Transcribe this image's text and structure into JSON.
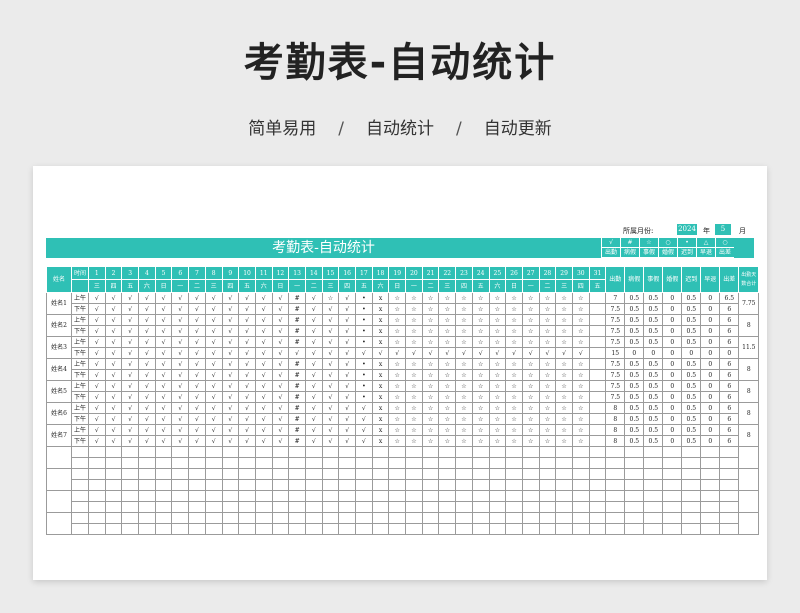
{
  "hero": {
    "title": "考勤表-自动统计"
  },
  "subtitle": {
    "items": [
      "简单易用",
      "自动统计",
      "自动更新"
    ],
    "sep": "/"
  },
  "month_row": {
    "label": "所属月份:",
    "year": "2024",
    "year_unit": "年",
    "month": "5",
    "month_unit": "月"
  },
  "sheet_title": "考勤表-自动统计",
  "legend": {
    "symbols": [
      "√",
      "#",
      "☆",
      "○",
      "•",
      "△",
      "○"
    ],
    "labels": [
      "出勤",
      "病假",
      "事假",
      "婚假",
      "迟到",
      "早退",
      "出差"
    ]
  },
  "header": {
    "name": "姓名",
    "time": "时间",
    "days": [
      "1",
      "2",
      "3",
      "4",
      "5",
      "6",
      "7",
      "8",
      "9",
      "10",
      "11",
      "12",
      "13",
      "14",
      "15",
      "16",
      "17",
      "18",
      "19",
      "20",
      "21",
      "22",
      "23",
      "24",
      "25",
      "26",
      "27",
      "28",
      "29",
      "30",
      "31"
    ],
    "weekdays": [
      "三",
      "四",
      "五",
      "六",
      "日",
      "一",
      "二",
      "三",
      "四",
      "五",
      "六",
      "日",
      "一",
      "二",
      "三",
      "四",
      "五",
      "六",
      "日",
      "一",
      "二",
      "三",
      "四",
      "五",
      "六",
      "日",
      "一",
      "二",
      "三",
      "四",
      "五"
    ],
    "stats": [
      "出勤",
      "病假",
      "事假",
      "婚假",
      "迟到",
      "早退",
      "出差"
    ],
    "total": "出勤天数合计"
  },
  "employees": [
    {
      "name": "姓名1",
      "total": "7.75",
      "rows": [
        {
          "time": "上午",
          "marks": [
            "√",
            "√",
            "√",
            "√",
            "√",
            "√",
            "√",
            "√",
            "√",
            "√",
            "√",
            "√",
            "#",
            "√",
            "☆",
            "√",
            "•",
            "x",
            "☆",
            "☆",
            "☆",
            "☆",
            "☆",
            "☆",
            "☆",
            "☆",
            "☆",
            "☆",
            "☆",
            "☆",
            ""
          ],
          "stats": [
            "7",
            "0.5",
            "0.5",
            "0",
            "0.5",
            "0",
            "6.5"
          ]
        },
        {
          "time": "下午",
          "marks": [
            "√",
            "√",
            "√",
            "√",
            "√",
            "√",
            "√",
            "√",
            "√",
            "√",
            "√",
            "√",
            "#",
            "√",
            "√",
            "√",
            "•",
            "x",
            "☆",
            "☆",
            "☆",
            "☆",
            "☆",
            "☆",
            "☆",
            "☆",
            "☆",
            "☆",
            "☆",
            "☆",
            ""
          ],
          "stats": [
            "7.5",
            "0.5",
            "0.5",
            "0",
            "0.5",
            "0",
            "6"
          ]
        }
      ]
    },
    {
      "name": "姓名2",
      "total": "8",
      "rows": [
        {
          "time": "上午",
          "marks": [
            "√",
            "√",
            "√",
            "√",
            "√",
            "√",
            "√",
            "√",
            "√",
            "√",
            "√",
            "√",
            "#",
            "√",
            "√",
            "√",
            "•",
            "x",
            "☆",
            "☆",
            "☆",
            "☆",
            "☆",
            "☆",
            "☆",
            "☆",
            "☆",
            "☆",
            "☆",
            "☆",
            ""
          ],
          "stats": [
            "7.5",
            "0.5",
            "0.5",
            "0",
            "0.5",
            "0",
            "6"
          ]
        },
        {
          "time": "下午",
          "marks": [
            "√",
            "√",
            "√",
            "√",
            "√",
            "√",
            "√",
            "√",
            "√",
            "√",
            "√",
            "√",
            "#",
            "√",
            "√",
            "√",
            "•",
            "x",
            "☆",
            "☆",
            "☆",
            "☆",
            "☆",
            "☆",
            "☆",
            "☆",
            "☆",
            "☆",
            "☆",
            "☆",
            ""
          ],
          "stats": [
            "7.5",
            "0.5",
            "0.5",
            "0",
            "0.5",
            "0",
            "6"
          ]
        }
      ]
    },
    {
      "name": "姓名3",
      "total": "11.5",
      "rows": [
        {
          "time": "上午",
          "marks": [
            "√",
            "√",
            "√",
            "√",
            "√",
            "√",
            "√",
            "√",
            "√",
            "√",
            "√",
            "√",
            "#",
            "√",
            "√",
            "√",
            "•",
            "x",
            "☆",
            "☆",
            "☆",
            "☆",
            "☆",
            "☆",
            "☆",
            "☆",
            "☆",
            "☆",
            "☆",
            "☆",
            ""
          ],
          "stats": [
            "7.5",
            "0.5",
            "0.5",
            "0",
            "0.5",
            "0",
            "6"
          ]
        },
        {
          "time": "下午",
          "marks": [
            "√",
            "√",
            "√",
            "√",
            "√",
            "√",
            "√",
            "√",
            "√",
            "√",
            "√",
            "√",
            "√",
            "√",
            "√",
            "√",
            "√",
            "√",
            "√",
            "√",
            "√",
            "√",
            "√",
            "√",
            "√",
            "√",
            "√",
            "√",
            "√",
            "√",
            ""
          ],
          "stats": [
            "15",
            "0",
            "0",
            "0",
            "0",
            "0",
            "0"
          ]
        }
      ]
    },
    {
      "name": "姓名4",
      "total": "8",
      "rows": [
        {
          "time": "上午",
          "marks": [
            "√",
            "√",
            "√",
            "√",
            "√",
            "√",
            "√",
            "√",
            "√",
            "√",
            "√",
            "√",
            "#",
            "√",
            "√",
            "√",
            "•",
            "x",
            "☆",
            "☆",
            "☆",
            "☆",
            "☆",
            "☆",
            "☆",
            "☆",
            "☆",
            "☆",
            "☆",
            "☆",
            ""
          ],
          "stats": [
            "7.5",
            "0.5",
            "0.5",
            "0",
            "0.5",
            "0",
            "6"
          ]
        },
        {
          "time": "下午",
          "marks": [
            "√",
            "√",
            "√",
            "√",
            "√",
            "√",
            "√",
            "√",
            "√",
            "√",
            "√",
            "√",
            "#",
            "√",
            "√",
            "√",
            "•",
            "x",
            "☆",
            "☆",
            "☆",
            "☆",
            "☆",
            "☆",
            "☆",
            "☆",
            "☆",
            "☆",
            "☆",
            "☆",
            ""
          ],
          "stats": [
            "7.5",
            "0.5",
            "0.5",
            "0",
            "0.5",
            "0",
            "6"
          ]
        }
      ]
    },
    {
      "name": "姓名5",
      "total": "8",
      "rows": [
        {
          "time": "上午",
          "marks": [
            "√",
            "√",
            "√",
            "√",
            "√",
            "√",
            "√",
            "√",
            "√",
            "√",
            "√",
            "√",
            "#",
            "√",
            "√",
            "√",
            "•",
            "x",
            "☆",
            "☆",
            "☆",
            "☆",
            "☆",
            "☆",
            "☆",
            "☆",
            "☆",
            "☆",
            "☆",
            "☆",
            ""
          ],
          "stats": [
            "7.5",
            "0.5",
            "0.5",
            "0",
            "0.5",
            "0",
            "6"
          ]
        },
        {
          "time": "下午",
          "marks": [
            "√",
            "√",
            "√",
            "√",
            "√",
            "√",
            "√",
            "√",
            "√",
            "√",
            "√",
            "√",
            "#",
            "√",
            "√",
            "√",
            "•",
            "x",
            "☆",
            "☆",
            "☆",
            "☆",
            "☆",
            "☆",
            "☆",
            "☆",
            "☆",
            "☆",
            "☆",
            "☆",
            ""
          ],
          "stats": [
            "7.5",
            "0.5",
            "0.5",
            "0",
            "0.5",
            "0",
            "6"
          ]
        }
      ]
    },
    {
      "name": "姓名6",
      "total": "8",
      "rows": [
        {
          "time": "上午",
          "marks": [
            "√",
            "√",
            "√",
            "√",
            "√",
            "√",
            "√",
            "√",
            "√",
            "√",
            "√",
            "√",
            "#",
            "√",
            "√",
            "√",
            "√",
            "x",
            "☆",
            "☆",
            "☆",
            "☆",
            "☆",
            "☆",
            "☆",
            "☆",
            "☆",
            "☆",
            "☆",
            "☆",
            ""
          ],
          "stats": [
            "8",
            "0.5",
            "0.5",
            "0",
            "0.5",
            "0",
            "6"
          ]
        },
        {
          "time": "下午",
          "marks": [
            "√",
            "√",
            "√",
            "√",
            "√",
            "√",
            "√",
            "√",
            "√",
            "√",
            "√",
            "√",
            "#",
            "√",
            "√",
            "√",
            "√",
            "x",
            "☆",
            "☆",
            "☆",
            "☆",
            "☆",
            "☆",
            "☆",
            "☆",
            "☆",
            "☆",
            "☆",
            "☆",
            ""
          ],
          "stats": [
            "8",
            "0.5",
            "0.5",
            "0",
            "0.5",
            "0",
            "6"
          ]
        }
      ]
    },
    {
      "name": "姓名7",
      "total": "8",
      "rows": [
        {
          "time": "上午",
          "marks": [
            "√",
            "√",
            "√",
            "√",
            "√",
            "√",
            "√",
            "√",
            "√",
            "√",
            "√",
            "√",
            "#",
            "√",
            "√",
            "√",
            "√",
            "x",
            "☆",
            "☆",
            "☆",
            "☆",
            "☆",
            "☆",
            "☆",
            "☆",
            "☆",
            "☆",
            "☆",
            "☆",
            ""
          ],
          "stats": [
            "8",
            "0.5",
            "0.5",
            "0",
            "0.5",
            "0",
            "6"
          ]
        },
        {
          "time": "下午",
          "marks": [
            "√",
            "√",
            "√",
            "√",
            "√",
            "√",
            "√",
            "√",
            "√",
            "√",
            "√",
            "√",
            "#",
            "√",
            "√",
            "√",
            "√",
            "x",
            "☆",
            "☆",
            "☆",
            "☆",
            "☆",
            "☆",
            "☆",
            "☆",
            "☆",
            "☆",
            "☆",
            "☆",
            ""
          ],
          "stats": [
            "8",
            "0.5",
            "0.5",
            "0",
            "0.5",
            "0",
            "6"
          ]
        }
      ]
    }
  ],
  "empty_groups": 4
}
